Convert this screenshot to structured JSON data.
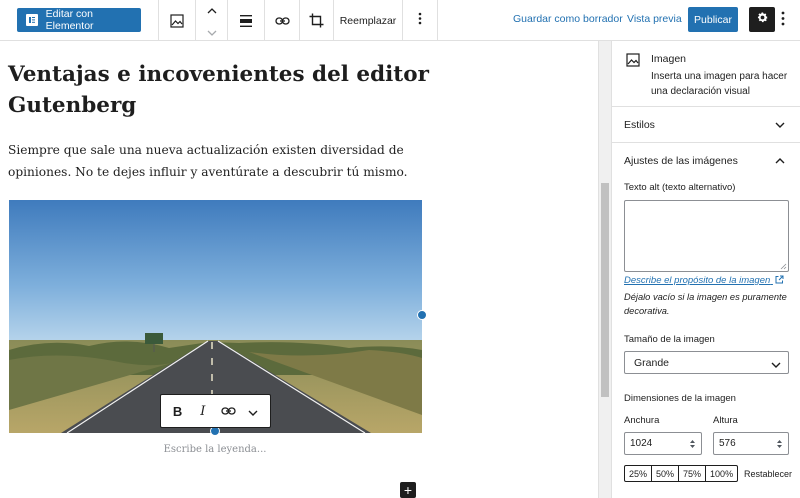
{
  "toolbar": {
    "elementor_label": "Editar con Elementor",
    "replace_label": "Reemplazar",
    "save_draft_label": "Guardar como borrador",
    "preview_label": "Vista previa",
    "publish_label": "Publicar"
  },
  "post": {
    "title": "Ventajas e incovenientes del editor Gutenberg",
    "paragraph": "Siempre que sale una nueva actualización existen diversidad de opiniones. No te dejes influir y aventúrate a descubrir tú mismo.",
    "caption_placeholder": "Escribe la leyenda..."
  },
  "image_toolbar": {
    "bold": "B",
    "italic": "I"
  },
  "sidebar": {
    "block_title": "Imagen",
    "block_description": "Inserta una imagen para hacer una declaración visual",
    "styles_label": "Estilos",
    "image_settings_label": "Ajustes de las imágenes",
    "alt_label": "Texto alt (texto alternativo)",
    "alt_value": "",
    "alt_help_link": "Describe el propósito de la imagen",
    "alt_help_text": "Déjalo vacío si la imagen es puramente decorativa.",
    "size_label": "Tamaño de la imagen",
    "size_value": "Grande",
    "dimensions_label": "Dimensiones de la imagen",
    "width_label": "Anchura",
    "width_value": "1024",
    "height_label": "Altura",
    "height_value": "576",
    "percentages": [
      "25%",
      "50%",
      "75%",
      "100%"
    ],
    "reset_label": "Restablecer"
  },
  "colors": {
    "accent": "#2271b1",
    "dark": "#1e1e1e",
    "border": "#e0e0e0"
  }
}
